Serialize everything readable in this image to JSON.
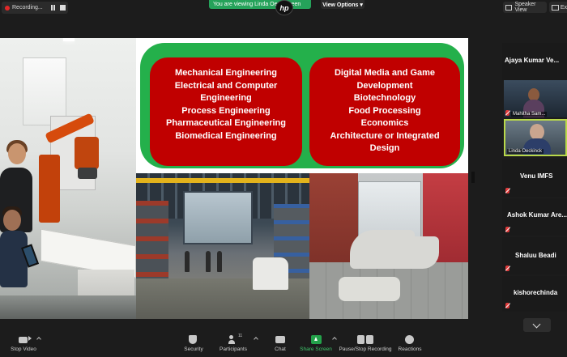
{
  "topbar": {
    "recording_label": "Recording...",
    "viewing_banner": "You are viewing Linda Oe... screen",
    "logo_text": "hp",
    "view_options_label": "View Options ▾",
    "speaker_view_label": "Speaker View",
    "exit_label": "Ex"
  },
  "slide": {
    "left_box": [
      "Mechanical Engineering",
      "Electrical and Computer",
      "Engineering",
      "Process Engineering",
      "Pharmaceutical Engineering",
      "Biomedical Engineering"
    ],
    "right_box": [
      "Digital Media and Game",
      "Development",
      "Biotechnology",
      "Food Processing",
      "Economics",
      "Architecture or Integrated",
      "Design"
    ],
    "panel_color": "#24b04b",
    "box_color": "#c00000"
  },
  "participants": [
    {
      "name": "Ajaya Kumar Ve...",
      "muted": false,
      "video": false
    },
    {
      "name": "Mahitha Sam...",
      "muted": true,
      "video": true
    },
    {
      "name": "Linda Oeckinck",
      "muted": false,
      "video": true,
      "active_speaker": true
    },
    {
      "name": "Venu IMFS",
      "muted": true,
      "video": false
    },
    {
      "name": "Ashok Kumar Are...",
      "muted": true,
      "video": false
    },
    {
      "name": "Shaluu Beadi",
      "muted": true,
      "video": false
    },
    {
      "name": "kishorechinda",
      "muted": true,
      "video": false
    }
  ],
  "toolbar": {
    "stop_video": "Stop Video",
    "security": "Security",
    "participants": "Participants",
    "participant_count": "11",
    "chat": "Chat",
    "share_screen": "Share Screen",
    "pause_stop_recording": "Pause/Stop Recording",
    "reactions": "Reactions"
  }
}
